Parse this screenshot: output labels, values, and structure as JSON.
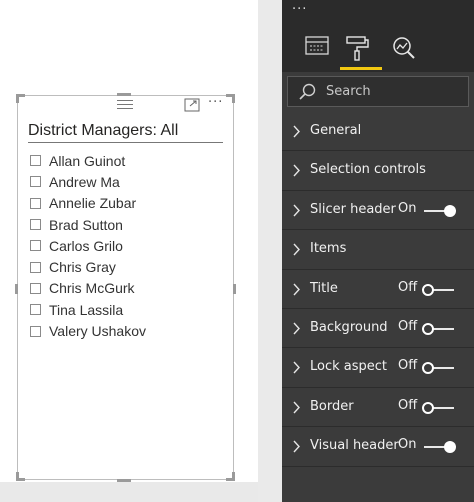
{
  "slicer": {
    "header": "District Managers: All",
    "more_glyph": "···",
    "items": [
      {
        "label": "Allan Guinot"
      },
      {
        "label": "Andrew Ma"
      },
      {
        "label": "Annelie Zubar"
      },
      {
        "label": "Brad Sutton"
      },
      {
        "label": "Carlos Grilo"
      },
      {
        "label": "Chris Gray"
      },
      {
        "label": "Chris McGurk"
      },
      {
        "label": "Tina Lassila"
      },
      {
        "label": "Valery Ushakov"
      }
    ]
  },
  "pane": {
    "more_glyph": "···",
    "tabs": [
      {
        "icon": "fields-icon"
      },
      {
        "icon": "paint-roller-icon",
        "selected": true
      },
      {
        "icon": "analytics-icon"
      }
    ],
    "search": {
      "placeholder": "Search",
      "value": ""
    },
    "cards": [
      {
        "label": "General"
      },
      {
        "label": "Selection controls"
      },
      {
        "label": "Slicer header",
        "state": "On"
      },
      {
        "label": "Items"
      },
      {
        "label": "Title",
        "state": "Off"
      },
      {
        "label": "Background",
        "state": "Off"
      },
      {
        "label": "Lock aspect",
        "state": "Off"
      },
      {
        "label": "Border",
        "state": "Off"
      },
      {
        "label": "Visual header",
        "state": "On"
      }
    ]
  },
  "colors": {
    "pane_background": "#3b3b3b",
    "pane_header": "#2b2b2b",
    "selected_tab_accent": "#f2c811",
    "canvas_background": "#ffffff"
  }
}
